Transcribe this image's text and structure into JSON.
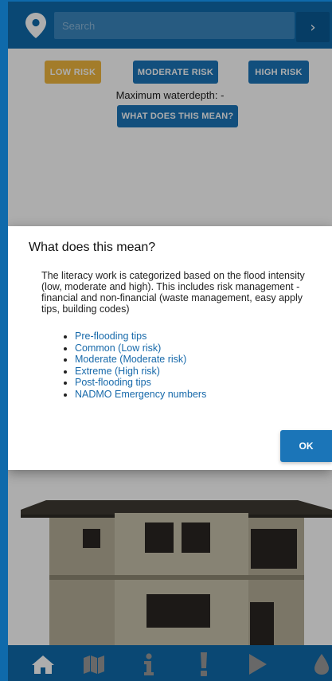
{
  "search": {
    "placeholder": "Search",
    "go_label": "›"
  },
  "risk": {
    "low_label": "LOW RISK",
    "moderate_label": "MODERATE RISK",
    "high_label": "HIGH RISK",
    "waterdepth_text": "Maximum waterdepth: -",
    "meaning_label": "WHAT DOES THIS MEAN?"
  },
  "dialog": {
    "title": "What does this mean?",
    "body": "The literacy work is categorized based on the flood intensity (low, moderate and high). This includes risk management - financial and non-financial (waste management, easy apply tips, building codes)",
    "links": [
      "Pre-flooding tips",
      "Common (Low risk)",
      "Moderate (Moderate risk)",
      "Extreme (High risk)",
      "Post-flooding tips",
      "NADMO Emergency numbers"
    ],
    "ok_label": "OK"
  },
  "nav": {
    "items": [
      {
        "icon": "home-icon"
      },
      {
        "icon": "map-icon"
      },
      {
        "icon": "info-icon"
      },
      {
        "icon": "alert-icon"
      },
      {
        "icon": "play-icon"
      },
      {
        "icon": "water-drop-icon"
      }
    ]
  },
  "colors": {
    "primary": "#0f6aab",
    "button_blue": "#1b75b8",
    "low_risk": "#f0b73f",
    "link": "#1769aa"
  }
}
